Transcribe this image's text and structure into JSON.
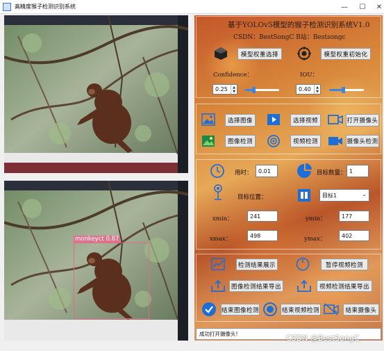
{
  "window": {
    "title": "高精度猴子检测识别系统"
  },
  "detection": {
    "label": "monkeyct 0.87"
  },
  "header": {
    "title": "基于YOLOv5模型的猴子检测识别系统V1.0",
    "subtitle": "CSDN：BestSongC   B站：Bestsongc"
  },
  "model": {
    "select_weights": "模型权重选择",
    "init_weights": "模型权重初始化",
    "confidence_label": "Confidence：",
    "iou_label": "IOU：",
    "confidence_value": "0.25",
    "iou_value": "0.40",
    "confidence_level": 0.25,
    "iou_level": 0.4
  },
  "io": {
    "select_image": "选择图像",
    "select_video": "选择视频",
    "open_camera": "打开摄像头",
    "image_detect": "图像检测",
    "video_detect": "视频检测",
    "camera_detect": "摄像头检测"
  },
  "results": {
    "time_label": "用时：",
    "time_value": "0.01",
    "count_label": "目标数量：",
    "count_value": "1",
    "position_label": "目标位置：",
    "target_select": "目标1",
    "xmin_label": "xmin：",
    "xmin_value": "241",
    "ymin_label": "ymin：",
    "ymin_value": "177",
    "xmax_label": "xmax：",
    "xmax_value": "498",
    "ymax_label": "ymax：",
    "ymax_value": "402"
  },
  "actions": {
    "show_results": "检测结果展示",
    "pause_video": "暂停视频检测",
    "export_image": "图像检测结果导出",
    "export_video": "视频检测结果导出",
    "end_image": "结束图像检测",
    "end_video": "结束视频检测",
    "end_camera": "结束摄像头"
  },
  "status": {
    "message": "成功打开摄像头!"
  },
  "watermark": "CSDN @BestSongC",
  "colors": {
    "accent": "#3a86e0",
    "box": "#e36b8a"
  }
}
